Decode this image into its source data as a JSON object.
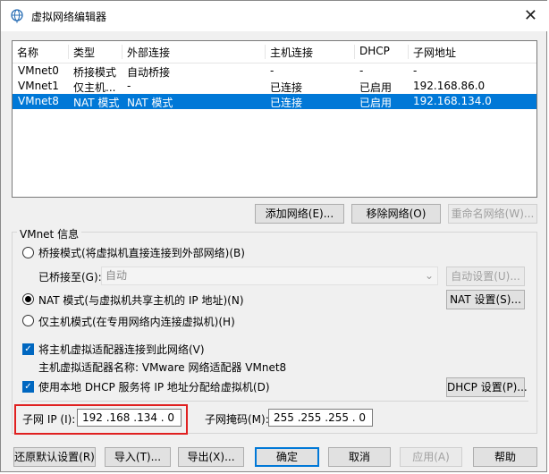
{
  "window": {
    "title": "虚拟网络编辑器",
    "close": "✕"
  },
  "table": {
    "headers": [
      "名称",
      "类型",
      "外部连接",
      "主机连接",
      "DHCP",
      "子网地址"
    ],
    "rows": [
      [
        "VMnet0",
        "桥接模式",
        "自动桥接",
        "-",
        "-",
        "-"
      ],
      [
        "VMnet1",
        "仅主机...",
        "-",
        "已连接",
        "已启用",
        "192.168.86.0"
      ],
      [
        "VMnet8",
        "NAT 模式",
        "NAT 模式",
        "已连接",
        "已启用",
        "192.168.134.0"
      ]
    ],
    "selected_row": 2
  },
  "table_buttons": {
    "add": "添加网络(E)...",
    "remove": "移除网络(O)",
    "rename": "重命名网络(W)..."
  },
  "vmnet_info": {
    "title": "VMnet 信息",
    "bridged": "桥接模式(将虚拟机直接连接到外部网络)(B)",
    "bridged_to_label": "已桥接至(G):",
    "bridged_to_value": "自动",
    "auto_settings": "自动设置(U)...",
    "nat": "NAT 模式(与虚拟机共享主机的 IP 地址)(N)",
    "nat_settings": "NAT 设置(S)...",
    "host_only": "仅主机模式(在专用网络内连接虚拟机)(H)",
    "connect_adapter": "将主机虚拟适配器连接到此网络(V)",
    "adapter_name": "主机虚拟适配器名称: VMware 网络适配器 VMnet8",
    "use_dhcp": "使用本地 DHCP 服务将 IP 地址分配给虚拟机(D)",
    "dhcp_settings": "DHCP 设置(P)...",
    "subnet_ip_label": "子网 IP (I):",
    "subnet_ip": "192 .168 .134 .  0",
    "subnet_mask_label": "子网掩码(M):",
    "subnet_mask": "255 .255 .255 .  0"
  },
  "footer": {
    "restore": "还原默认设置(R)",
    "import": "导入(T)...",
    "export": "导出(X)...",
    "ok": "确定",
    "cancel": "取消",
    "apply": "应用(A)",
    "help": "帮助"
  }
}
